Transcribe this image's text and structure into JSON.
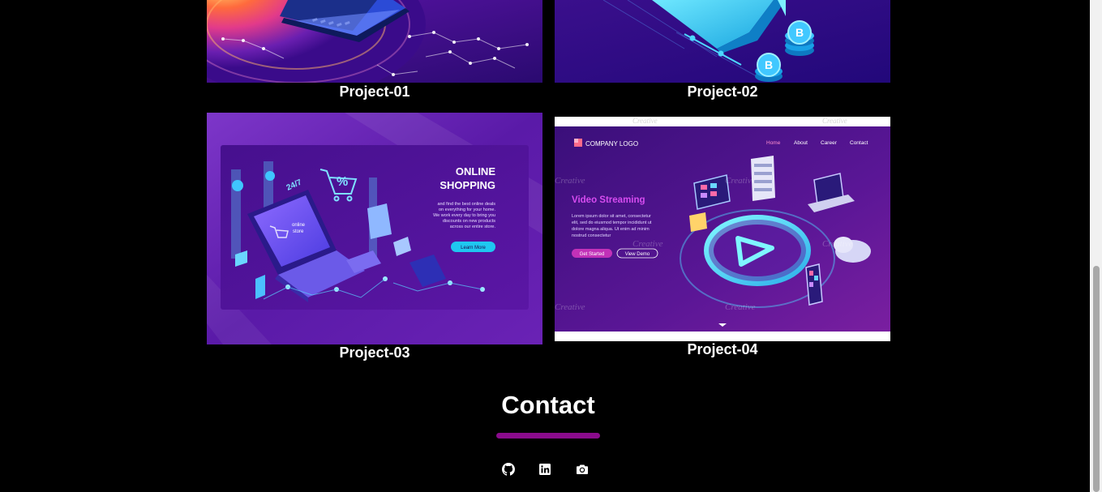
{
  "projects": [
    {
      "caption": "Project-01"
    },
    {
      "caption": "Project-02"
    },
    {
      "caption": "Project-03",
      "image_text": {
        "title_line1": "ONLINE",
        "title_line2": "SHOPPING",
        "body": [
          "and find the best online deals",
          "on everything for your home.",
          "We work every day to bring you",
          "discounts on new products",
          "across our entire store."
        ],
        "button": "Learn More",
        "badge_247": "24/7",
        "percent": "%",
        "laptop_label1": "online",
        "laptop_label2": "store"
      }
    },
    {
      "caption": "Project-04",
      "image_text": {
        "logo": "COMPANY LOGO",
        "nav": [
          "Home",
          "About",
          "Career",
          "Contact"
        ],
        "heading": "Video Streaming",
        "body": [
          "Lorem ipsum dolor sit amet, consectetur",
          "elit, sed do eiusmod tempor incididunt ut",
          "dolore magna aliqua. Ut enim ad minim",
          "nostrud consectetur"
        ],
        "btn_primary": "Get Started",
        "btn_secondary": "View Demo",
        "watermark": "Creative"
      }
    }
  ],
  "contact": {
    "title": "Contact"
  },
  "social_icons": [
    "github-icon",
    "linkedin-icon",
    "camera-icon"
  ],
  "colors": {
    "background": "#000000",
    "accent_underline": "#8a0b8c",
    "text": "#ffffff"
  }
}
